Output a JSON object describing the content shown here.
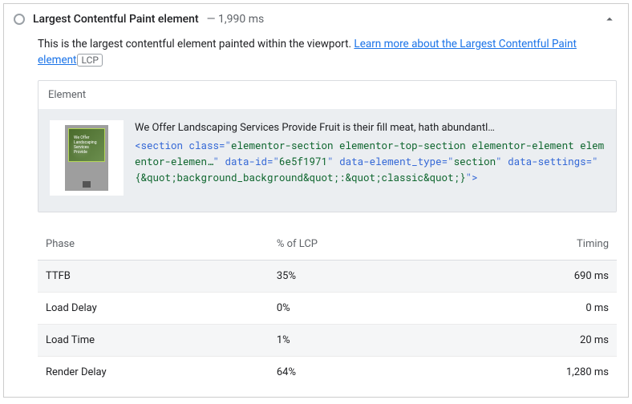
{
  "header": {
    "title": "Largest Contentful Paint element",
    "timing_sep": "—",
    "timing": "1,990 ms"
  },
  "description": {
    "text": "This is the largest contentful element painted within the viewport. ",
    "link": "Learn more about the Largest Contentful Paint element",
    "chip": "LCP"
  },
  "element": {
    "label": "Element",
    "snippet_text": "We Offer Landscaping Services Provide Fruit is their fill meat, hath abundantl…",
    "code_pre1": "<section class=\"",
    "code_cls": "elementor-section elementor-top-section elementor-element elementor-elemen…",
    "code_mid1": "\" data-id=\"",
    "code_id": "6e5f1971",
    "code_mid2": "\" data-element_type=\"",
    "code_type": "section",
    "code_mid3": "\" data-settings=\"",
    "code_set": "{&quot;background_background&quot;:&quot;classic&quot;}",
    "code_end": "\">"
  },
  "table": {
    "h1": "Phase",
    "h2": "% of LCP",
    "h3": "Timing",
    "rows": [
      {
        "phase": "TTFB",
        "pct": "35%",
        "timing": "690 ms"
      },
      {
        "phase": "Load Delay",
        "pct": "0%",
        "timing": "0 ms"
      },
      {
        "phase": "Load Time",
        "pct": "1%",
        "timing": "20 ms"
      },
      {
        "phase": "Render Delay",
        "pct": "64%",
        "timing": "1,280 ms"
      }
    ]
  }
}
